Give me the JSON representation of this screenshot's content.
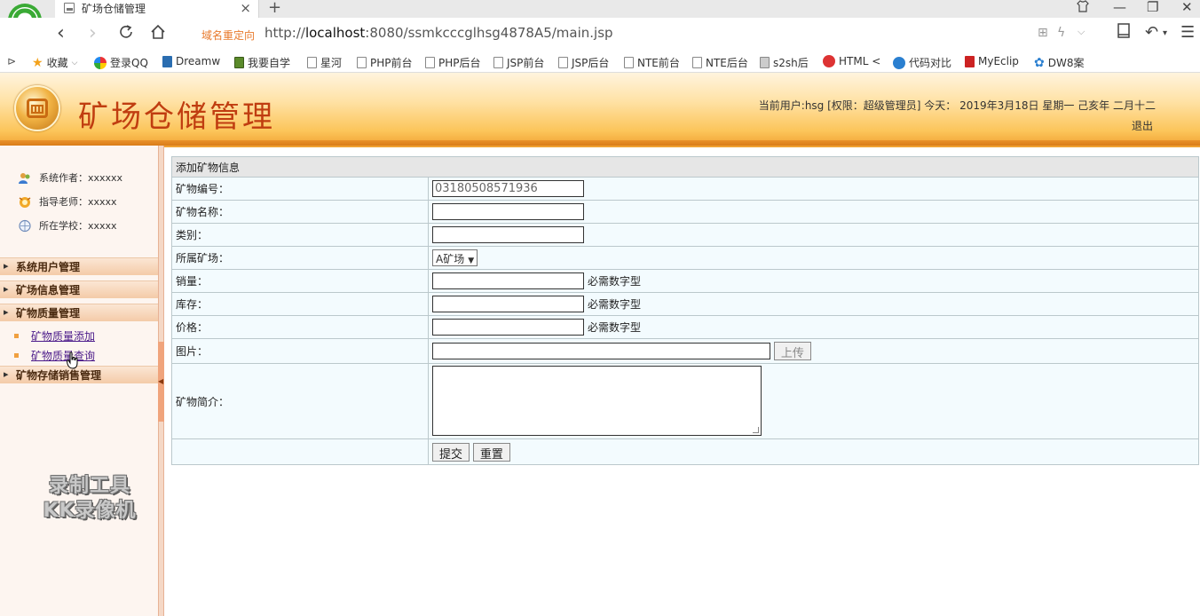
{
  "browser": {
    "tab_title": "矿场仓储管理",
    "redirect_label": "域名重定向",
    "url_prefix": "http://",
    "url_host": "localhost",
    "url_rest": ":8080/ssmkcccglhsg4878A5/main.jsp",
    "bookmarks": [
      {
        "label": "收藏",
        "icon": "star-icon"
      },
      {
        "label": "登录QQ",
        "icon": "qq-icon"
      },
      {
        "label": "Dreamw",
        "icon": "dreamweaver-icon"
      },
      {
        "label": "我要自学",
        "icon": "book-icon"
      },
      {
        "label": "星河",
        "icon": "page-icon"
      },
      {
        "label": "PHP前台",
        "icon": "page-icon"
      },
      {
        "label": "PHP后台",
        "icon": "page-icon"
      },
      {
        "label": "JSP前台",
        "icon": "page-icon"
      },
      {
        "label": "JSP后台",
        "icon": "page-icon"
      },
      {
        "label": "NTE前台",
        "icon": "page-icon"
      },
      {
        "label": "NTE后台",
        "icon": "page-icon"
      },
      {
        "label": "s2sh后",
        "icon": "image-icon"
      },
      {
        "label": "HTML <",
        "icon": "html-icon"
      },
      {
        "label": "代码对比",
        "icon": "compare-icon"
      },
      {
        "label": "MyEclip",
        "icon": "myeclipse-icon"
      },
      {
        "label": "DW8案",
        "icon": "paw-icon"
      }
    ]
  },
  "header": {
    "title": "矿场仓储管理",
    "user_info": "当前用户:hsg [权限：超级管理员] 今天： 2019年3月18日 星期一 己亥年 二月十二",
    "logout": "退出"
  },
  "sidebar": {
    "info": [
      {
        "label": "系统作者：xxxxxx",
        "icon": "user-icon"
      },
      {
        "label": "指导老师：xxxxx",
        "icon": "teacher-icon"
      },
      {
        "label": "所在学校：xxxxx",
        "icon": "school-icon"
      }
    ],
    "menus": [
      {
        "label": "系统用户管理"
      },
      {
        "label": "矿场信息管理"
      },
      {
        "label": "矿物质量管理"
      },
      {
        "label": "矿物存储销售管理"
      }
    ],
    "submenu": [
      {
        "label": "矿物质量添加"
      },
      {
        "label": "矿物质量查询"
      }
    ],
    "watermark_line1": "录制工具",
    "watermark_line2": "KK录像机"
  },
  "form": {
    "caption": "添加矿物信息",
    "fields": {
      "code": {
        "label": "矿物编号：",
        "value": "03180508571936"
      },
      "name": {
        "label": "矿物名称：",
        "value": ""
      },
      "category": {
        "label": "类别：",
        "value": ""
      },
      "mine": {
        "label": "所属矿场：",
        "value": "A矿场"
      },
      "sales": {
        "label": "销量：",
        "value": "",
        "hint": "必需数字型"
      },
      "stock": {
        "label": "库存：",
        "value": "",
        "hint": "必需数字型"
      },
      "price": {
        "label": "价格：",
        "value": "",
        "hint": "必需数字型"
      },
      "image": {
        "label": "图片：",
        "value": "",
        "button": "上传"
      },
      "intro": {
        "label": "矿物简介：",
        "value": ""
      }
    },
    "submit_label": "提交",
    "reset_label": "重置"
  }
}
